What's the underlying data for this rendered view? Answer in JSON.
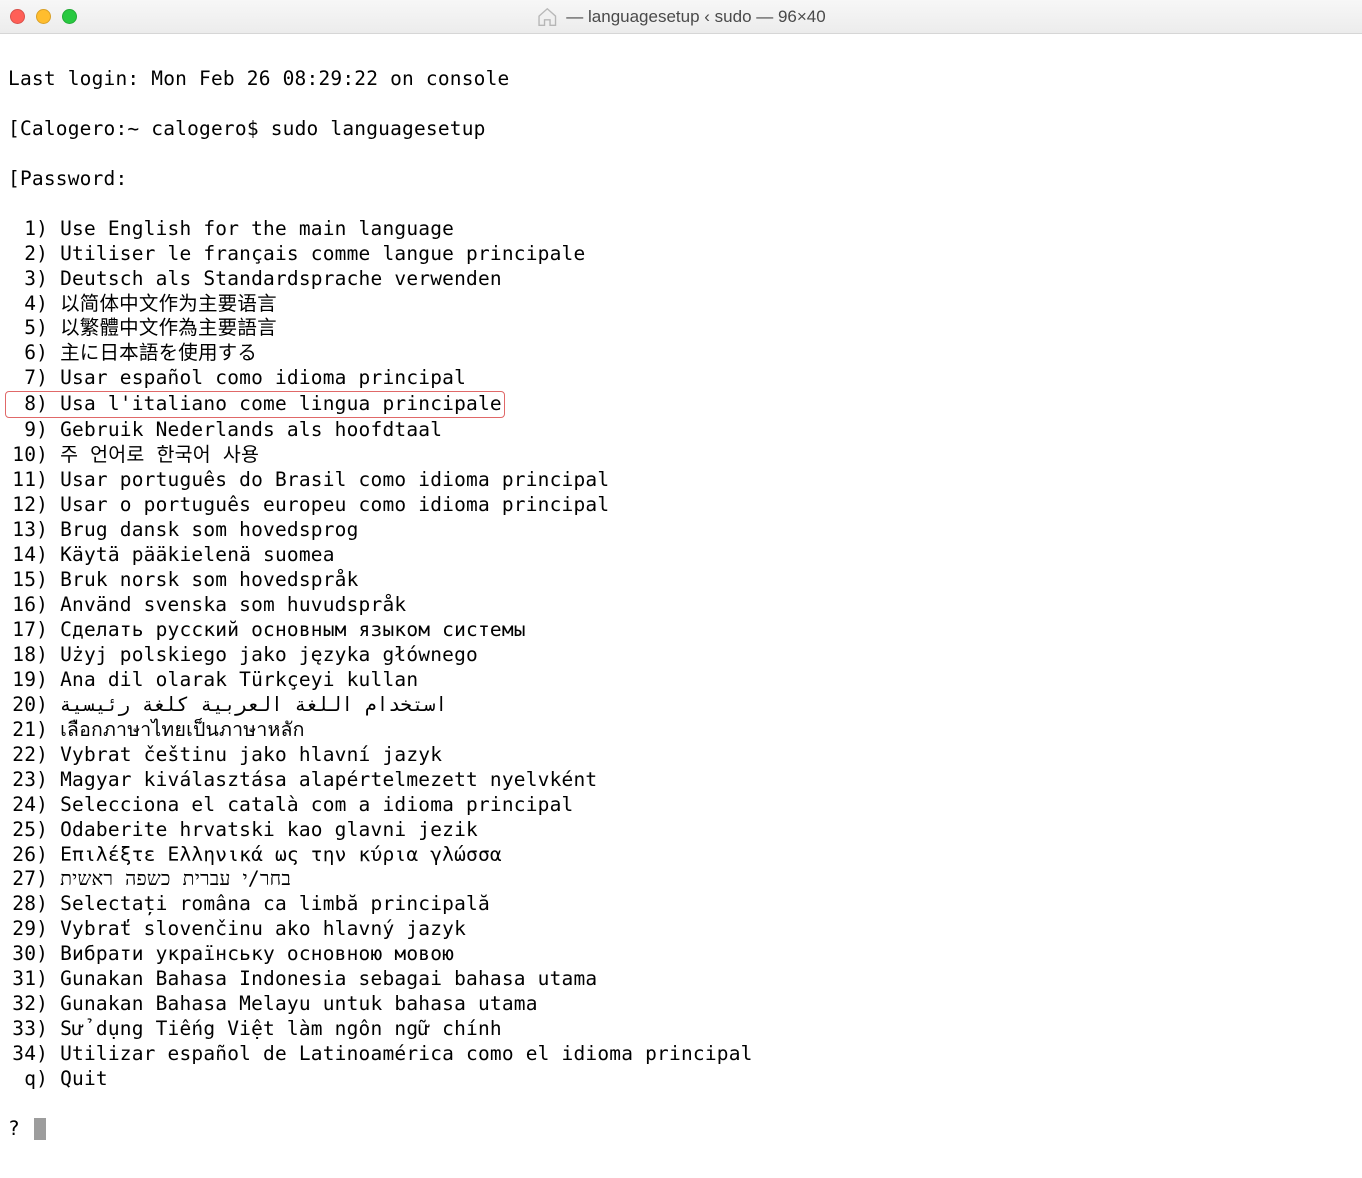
{
  "window": {
    "title": "— languagesetup ‹ sudo — 96×40"
  },
  "terminal": {
    "last_login": "Last login: Mon Feb 26 08:29:22 on console",
    "prompt_line": "Calogero:~ calogero$ sudo languagesetup",
    "password_line": "Password:",
    "options": [
      {
        "n": " 1",
        "t": "Use English for the main language"
      },
      {
        "n": " 2",
        "t": "Utiliser le français comme langue principale"
      },
      {
        "n": " 3",
        "t": "Deutsch als Standardsprache verwenden"
      },
      {
        "n": " 4",
        "t": "以简体中文作为主要语言"
      },
      {
        "n": " 5",
        "t": "以繁體中文作為主要語言"
      },
      {
        "n": " 6",
        "t": "主に日本語を使用する"
      },
      {
        "n": " 7",
        "t": "Usar español como idioma principal"
      },
      {
        "n": " 8",
        "t": "Usa l'italiano come lingua principale",
        "highlight": true
      },
      {
        "n": " 9",
        "t": "Gebruik Nederlands als hoofdtaal"
      },
      {
        "n": "10",
        "t": "주 언어로 한국어 사용"
      },
      {
        "n": "11",
        "t": "Usar português do Brasil como idioma principal"
      },
      {
        "n": "12",
        "t": "Usar o português europeu como idioma principal"
      },
      {
        "n": "13",
        "t": "Brug dansk som hovedsprog"
      },
      {
        "n": "14",
        "t": "Käytä pääkielenä suomea"
      },
      {
        "n": "15",
        "t": "Bruk norsk som hovedspråk"
      },
      {
        "n": "16",
        "t": "Använd svenska som huvudspråk"
      },
      {
        "n": "17",
        "t": "Сделать русский основным языком системы"
      },
      {
        "n": "18",
        "t": "Użyj polskiego jako języka głównego"
      },
      {
        "n": "19",
        "t": "Ana dil olarak Türkçeyi kullan"
      },
      {
        "n": "20",
        "t": "استخدام اللغة العربية كلغة رئيسية"
      },
      {
        "n": "21",
        "t": "เลือกภาษาไทยเป็นภาษาหลัก"
      },
      {
        "n": "22",
        "t": "Vybrat češtinu jako hlavní jazyk"
      },
      {
        "n": "23",
        "t": "Magyar kiválasztása alapértelmezett nyelvként"
      },
      {
        "n": "24",
        "t": "Selecciona el català com a idioma principal"
      },
      {
        "n": "25",
        "t": "Odaberite hrvatski kao glavni jezik"
      },
      {
        "n": "26",
        "t": "Επιλέξτε Ελληνικά ως την κύρια γλώσσα"
      },
      {
        "n": "27",
        "t": "בחר/י עברית כשפה ראשית"
      },
      {
        "n": "28",
        "t": "Selectați româna ca limbă principală"
      },
      {
        "n": "29",
        "t": "Vybrať slovenčinu ako hlavný jazyk"
      },
      {
        "n": "30",
        "t": "Вибрати українську основною мовою"
      },
      {
        "n": "31",
        "t": "Gunakan Bahasa Indonesia sebagai bahasa utama"
      },
      {
        "n": "32",
        "t": "Gunakan Bahasa Melayu untuk bahasa utama"
      },
      {
        "n": "33",
        "t": "Sử dụng Tiếng Việt làm ngôn ngữ chính"
      },
      {
        "n": "34",
        "t": "Utilizar español de Latinoamérica como el idioma principal"
      },
      {
        "n": " q",
        "t": "Quit"
      }
    ],
    "prompt_char": "?"
  }
}
